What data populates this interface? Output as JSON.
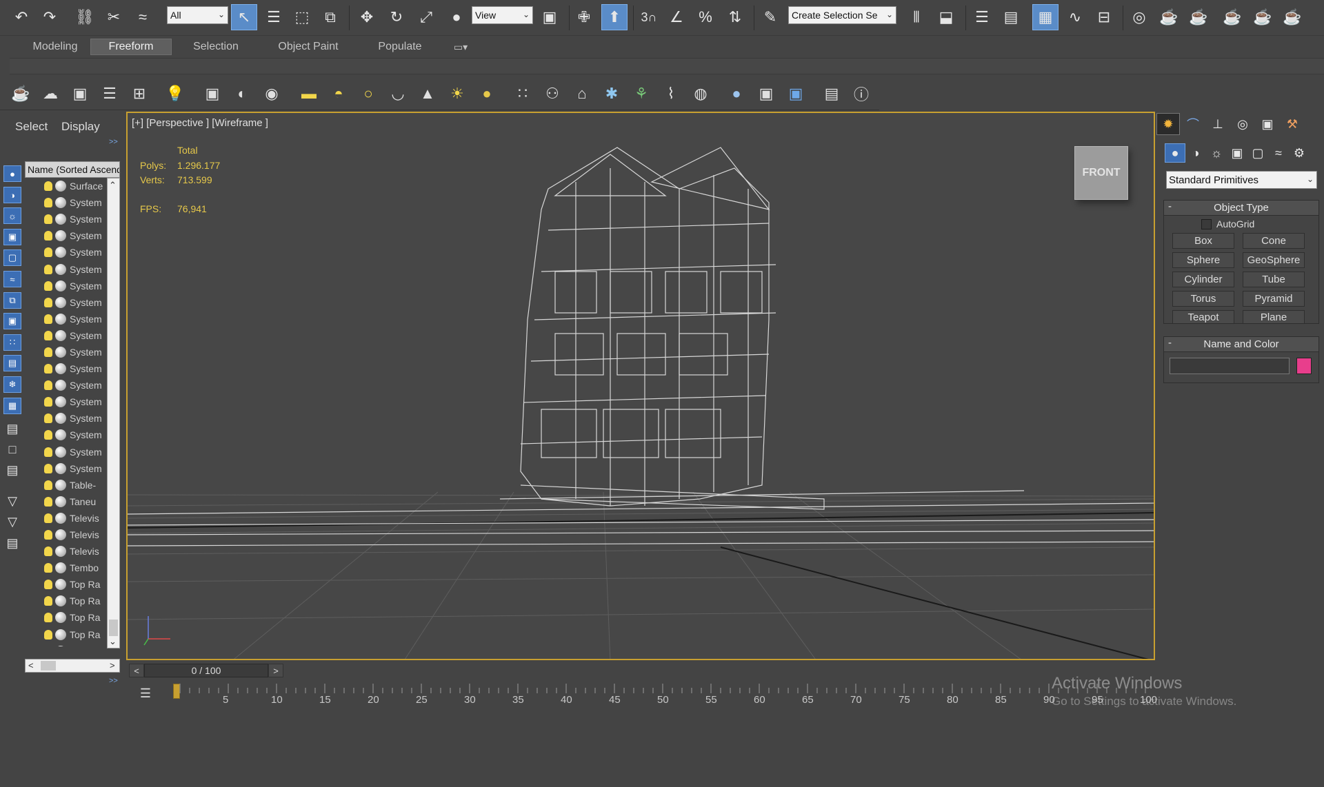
{
  "toolbar": {
    "selection_filter": "All",
    "ref_coord": "View",
    "snaps_3": "3",
    "named_selection": "Create Selection Se"
  },
  "ribbon": {
    "tabs": [
      "Modeling",
      "Freeform",
      "Selection",
      "Object Paint",
      "Populate"
    ],
    "active_tab": "Freeform"
  },
  "explorer": {
    "menu_select": "Select",
    "menu_display": "Display",
    "expand": ">>",
    "column_header": "Name (Sorted Ascending)",
    "items": [
      "Surface",
      "System",
      "System",
      "System",
      "System",
      "System",
      "System",
      "System",
      "System",
      "System",
      "System",
      "System",
      "System",
      "System",
      "System",
      "System",
      "System",
      "System",
      "Table-",
      "Taneu",
      "Televis",
      "Televis",
      "Televis",
      "Tembo",
      "Top Ra",
      "Top Ra",
      "Top Ra",
      "Top Ra",
      "Top Ra"
    ],
    "scroll_left": "<",
    "scroll_right": ">"
  },
  "viewport": {
    "label": "[+] [Perspective ] [Wireframe ]",
    "stats_total": "Total",
    "polys_label": "Polys:",
    "polys_value": "1.296.177",
    "verts_label": "Verts:",
    "verts_value": "713.599",
    "fps_label": "FPS:",
    "fps_value": "76,941",
    "viewcube_face": "FRONT"
  },
  "command_panel": {
    "primitive_category": "Standard Primitives",
    "object_type_title": "Object Type",
    "autogrid_label": "AutoGrid",
    "buttons": [
      "Box",
      "Cone",
      "Sphere",
      "GeoSphere",
      "Cylinder",
      "Tube",
      "Torus",
      "Pyramid",
      "Teapot",
      "Plane"
    ],
    "name_color_title": "Name and Color",
    "collapse_symbol": "-",
    "object_color": "#e83e8c"
  },
  "timeline": {
    "frame_display": "0 / 100",
    "prev": "<",
    "next": ">",
    "ticks": [
      "5",
      "10",
      "15",
      "20",
      "25",
      "30",
      "35",
      "40",
      "45",
      "50",
      "55",
      "60",
      "65",
      "70",
      "75",
      "80",
      "85",
      "90",
      "95",
      "100"
    ]
  },
  "watermark": {
    "line1": "Activate Windows",
    "line2": "Go to Settings to activate Windows."
  }
}
